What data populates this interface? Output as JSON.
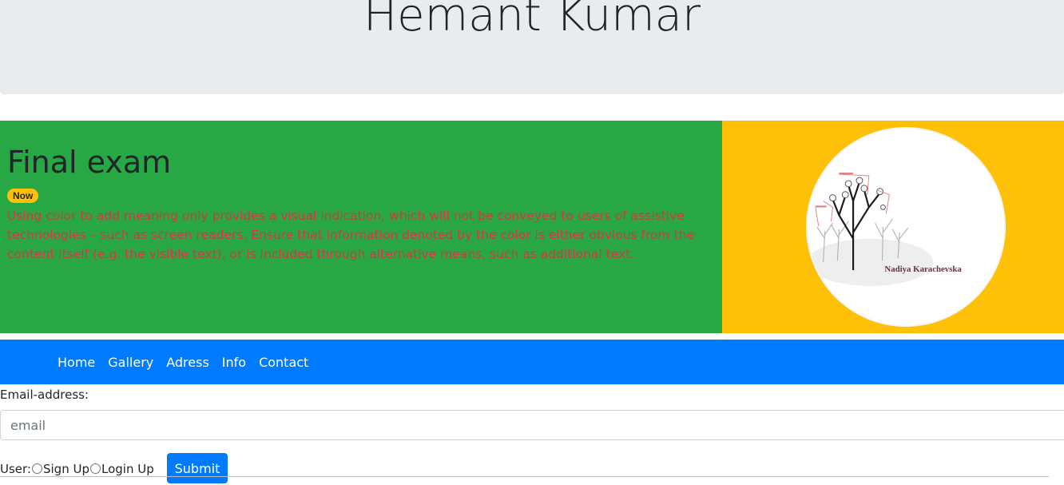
{
  "header": {
    "title": "Hemant Kumar"
  },
  "exam": {
    "title": "Final exam",
    "badge": "Now",
    "description": "Using color to add meaning only provides a visual indication, which will not be conveyed to users of assistive technologies – such as screen readers. Ensure that information denoted by the color is either obvious from the content itself (e.g. the visible text), or is included through alternative means, such as additional text."
  },
  "profile_image": {
    "caption": "Nadiya Karachevska"
  },
  "nav": {
    "items": [
      "Home",
      "Gallery",
      "Adress",
      "Info",
      "Contact"
    ]
  },
  "form": {
    "email_label": "Email-address:",
    "email_placeholder": "email",
    "user_label": "User:",
    "option_signup": "Sign Up",
    "option_login": "Login Up",
    "submit_label": "Submit"
  },
  "colors": {
    "jumbotron": "#e9ecef",
    "green_panel": "#28a745",
    "yellow_panel": "#ffc107",
    "navbar": "#007bff",
    "description_text": "#dc3545"
  }
}
